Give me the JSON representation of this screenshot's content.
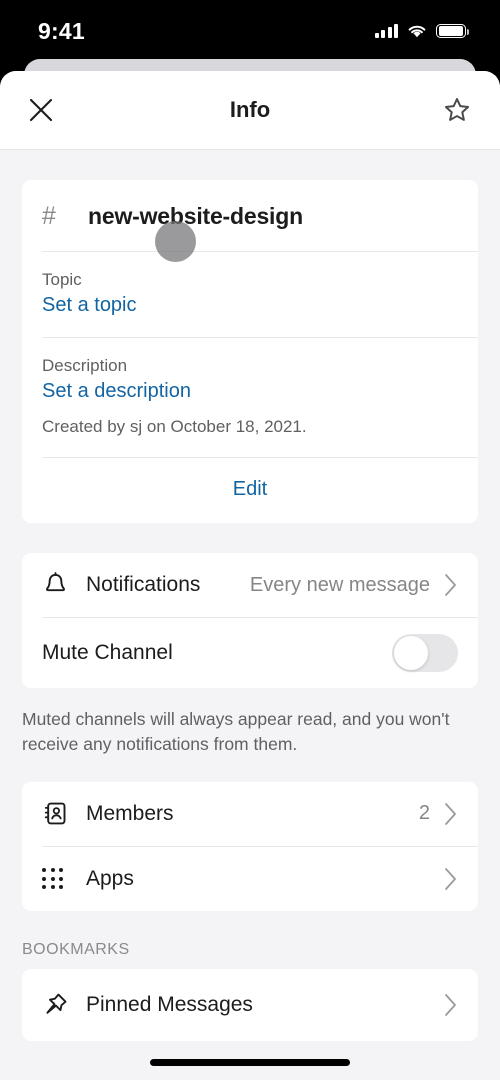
{
  "status_bar": {
    "time": "9:41",
    "signal_icon": "cellular-signal-icon",
    "wifi_icon": "wifi-icon",
    "battery_icon": "battery-icon"
  },
  "navbar": {
    "title": "Info",
    "close_icon": "close-icon",
    "star_icon": "star-outline-icon"
  },
  "channel": {
    "hash": "#",
    "name": "new-website-design",
    "topic_label": "Topic",
    "topic_value": "Set a topic",
    "description_label": "Description",
    "description_value": "Set a description",
    "created_meta": "Created by sj on October 18, 2021.",
    "edit_label": "Edit"
  },
  "notifications": {
    "bell_icon": "bell-icon",
    "label": "Notifications",
    "value": "Every new message",
    "chevron_icon": "chevron-right-icon",
    "mute_label": "Mute Channel",
    "mute_enabled": false,
    "helper_text": "Muted channels will always appear read, and you won't receive any notifications from them."
  },
  "links": [
    {
      "icon": "contact-card-icon",
      "label": "Members",
      "value": "2",
      "chevron_icon": "chevron-right-icon"
    },
    {
      "icon": "apps-grid-icon",
      "label": "Apps",
      "value": "",
      "chevron_icon": "chevron-right-icon"
    }
  ],
  "bookmarks": {
    "section_label": "BOOKMARKS",
    "items": [
      {
        "icon": "pin-icon",
        "label": "Pinned Messages",
        "chevron_icon": "chevron-right-icon"
      }
    ]
  },
  "colors": {
    "link_blue": "#1264a3",
    "background": "#f4f4f6",
    "card": "#ffffff",
    "text_primary": "#1d1c1d",
    "text_secondary": "#616061"
  },
  "cursor": {
    "visible": true
  }
}
